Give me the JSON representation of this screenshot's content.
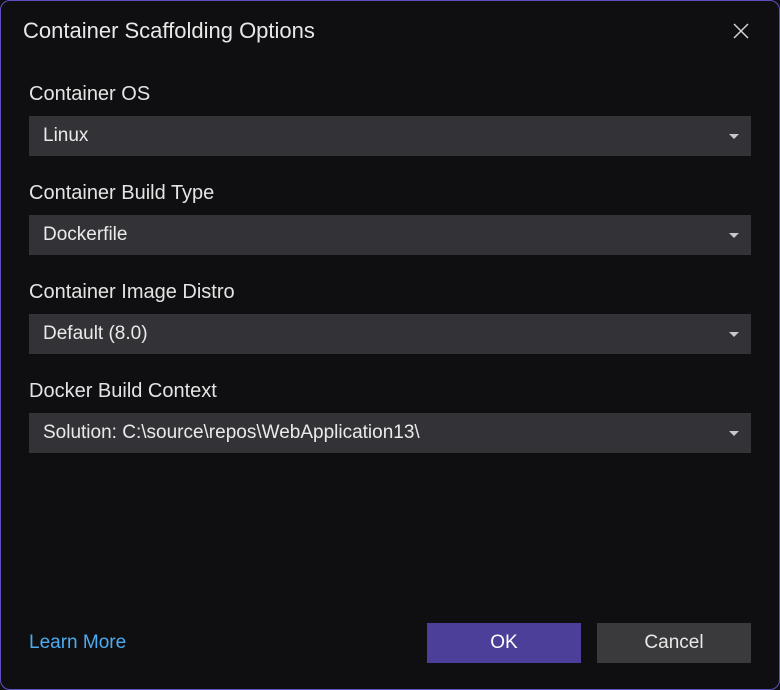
{
  "dialog": {
    "title": "Container Scaffolding Options"
  },
  "fields": {
    "containerOS": {
      "label": "Container OS",
      "value": "Linux"
    },
    "buildType": {
      "label": "Container Build Type",
      "value": "Dockerfile"
    },
    "imageDistro": {
      "label": "Container Image Distro",
      "value": "Default (8.0)"
    },
    "buildContext": {
      "label": "Docker Build Context",
      "value": "Solution: C:\\source\\repos\\WebApplication13\\"
    }
  },
  "footer": {
    "learnMore": "Learn More",
    "ok": "OK",
    "cancel": "Cancel"
  }
}
